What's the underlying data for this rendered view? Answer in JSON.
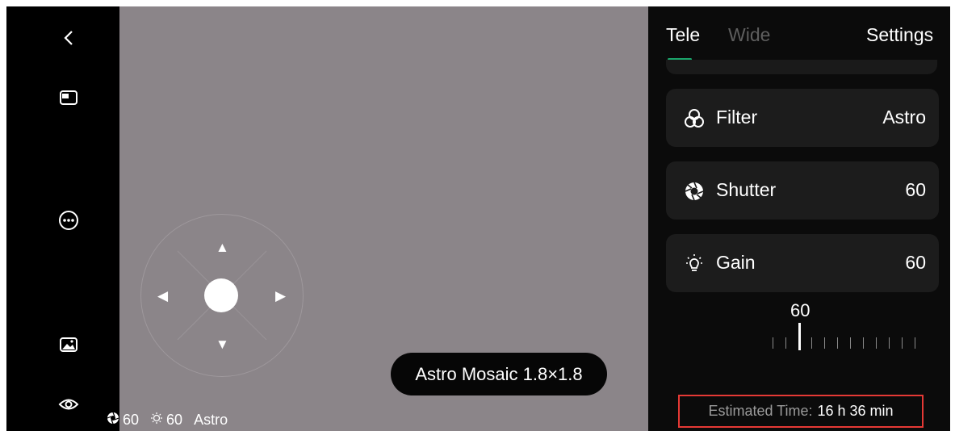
{
  "tabs": {
    "tele": "Tele",
    "wide": "Wide",
    "settings": "Settings"
  },
  "cards": [
    {
      "icon": "filter-icon",
      "label": "Filter",
      "value": "Astro"
    },
    {
      "icon": "shutter-icon",
      "label": "Shutter",
      "value": "60"
    },
    {
      "icon": "gain-icon",
      "label": "Gain",
      "value": "60"
    }
  ],
  "ruler": {
    "value": "60"
  },
  "estimate": {
    "label": "Estimated Time:",
    "value": "16 h 36 min"
  },
  "mosaic": {
    "label": "Astro Mosaic  1.8×1.8"
  },
  "status": {
    "shutter": "60",
    "gain": "60",
    "filter": "Astro"
  },
  "colors": {
    "accent": "#1aa56b",
    "highlight": "#e53935",
    "viewfinder": "#8b8589"
  },
  "joystick": {
    "up": "▲",
    "down": "▼",
    "left": "◀",
    "right": "▶"
  }
}
